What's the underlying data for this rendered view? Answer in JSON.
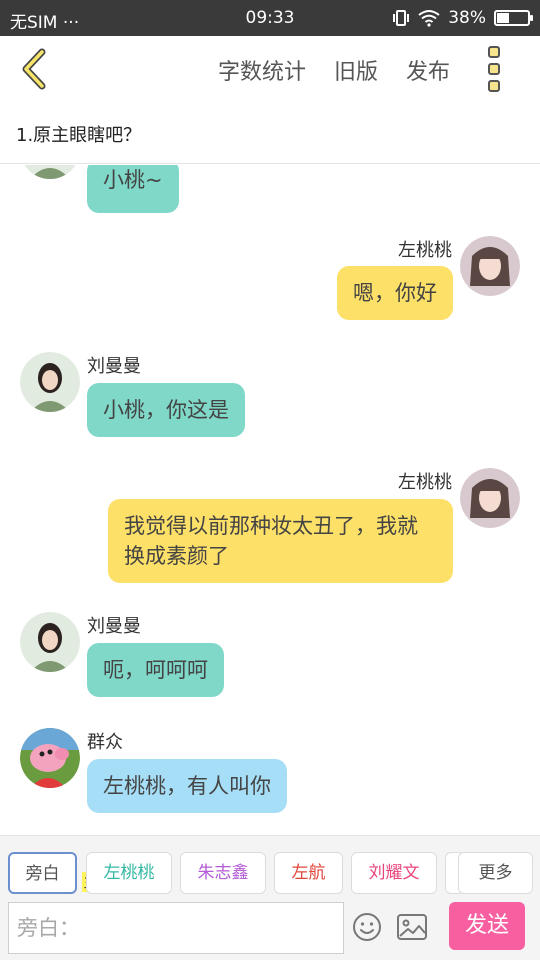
{
  "status_bar": {
    "carrier": "无SIM",
    "dots": "···",
    "time": "09:33",
    "battery": "38%",
    "battery_level": 0.38
  },
  "toolbar": {
    "word_count": "字数统计",
    "old_version": "旧版",
    "publish": "发布"
  },
  "chapter_title": "1.原主眼瞎吧？",
  "messages": [
    {
      "side": "left",
      "speaker": "",
      "text": "小桃~",
      "color": "#7fd8c8"
    },
    {
      "side": "right",
      "speaker": "左桃桃",
      "text": "嗯，你好",
      "color": "#fde068"
    },
    {
      "side": "left",
      "speaker": "刘曼曼",
      "text": "小桃，你这是",
      "color": "#7fd8c8"
    },
    {
      "side": "right",
      "speaker": "左桃桃",
      "text": "我觉得以前那种妆太丑了，我就换成素颜了",
      "color": "#fde068"
    },
    {
      "side": "left",
      "speaker": "刘曼曼",
      "text": "呃，呵呵呵",
      "color": "#7fd8c8"
    },
    {
      "side": "left",
      "speaker": "群众",
      "text": "左桃桃，有人叫你",
      "color": "#a5def6"
    }
  ],
  "roles": [
    {
      "label": "旁白",
      "color": "#555555"
    },
    {
      "label": "左桃桃",
      "color": "#35b9a3"
    },
    {
      "label": "朱志鑫",
      "color": "#b35ad6"
    },
    {
      "label": "左航",
      "color": "#e0453a"
    },
    {
      "label": "刘耀文",
      "color": "#e8457e"
    }
  ],
  "main_badge": "主",
  "more_label": "更多",
  "input": {
    "placeholder": "旁白："
  },
  "send_label": "发送"
}
